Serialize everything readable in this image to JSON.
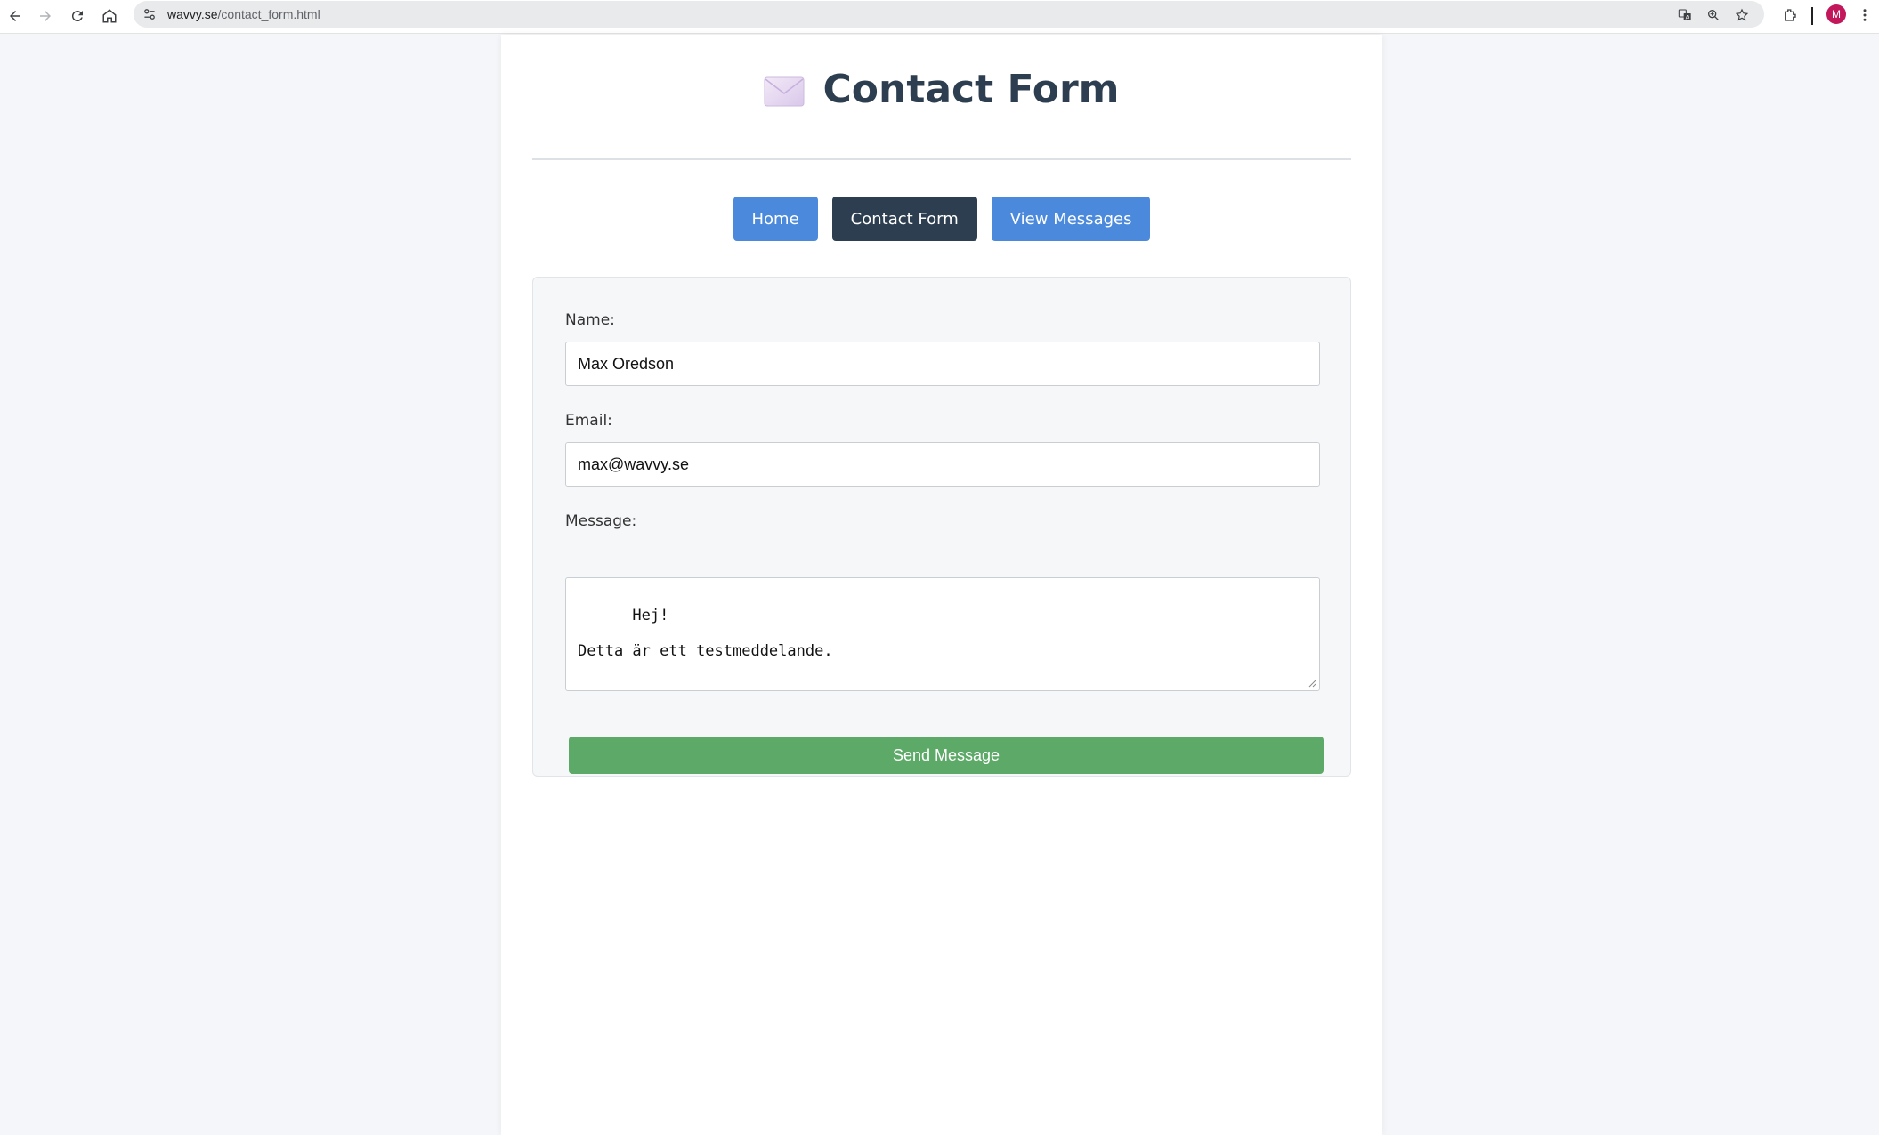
{
  "browser": {
    "url_host": "wavvy.se",
    "url_path": "/contact_form.html",
    "profile_initial": "M"
  },
  "page": {
    "title": "Contact Form",
    "title_icon": "envelope-icon"
  },
  "nav": {
    "items": [
      {
        "label": "Home",
        "active": false
      },
      {
        "label": "Contact Form",
        "active": true
      },
      {
        "label": "View Messages",
        "active": false
      }
    ]
  },
  "form": {
    "name_label": "Name:",
    "name_value": "Max Oredson",
    "email_label": "Email:",
    "email_value": "max@wavvy.se",
    "message_label": "Message:",
    "message_value": "Hej!\n\nDetta är ett testmeddelande.",
    "submit_label": "Send Message"
  },
  "colors": {
    "nav_button": "#4a89dc",
    "nav_active": "#2c3e50",
    "title": "#2c3e50",
    "submit": "#5daa68"
  }
}
